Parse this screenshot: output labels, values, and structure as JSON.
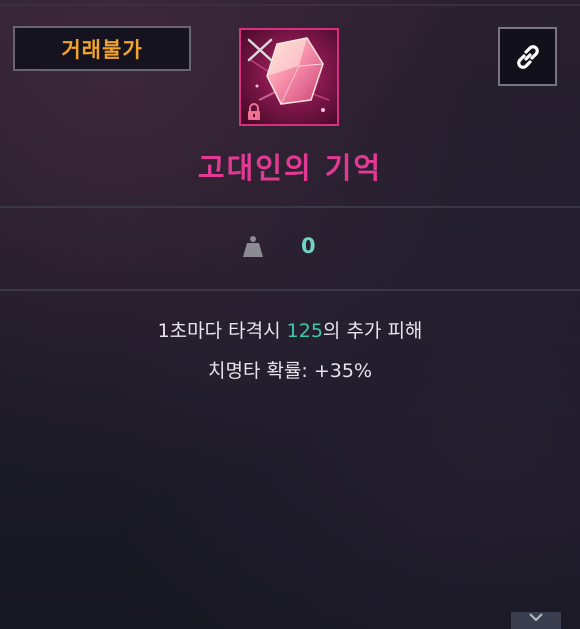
{
  "badge": {
    "label": "거래불가"
  },
  "item": {
    "name": "고대인의 기억",
    "rarity_color": "#e23a94",
    "icon": "pink-crystal-icon"
  },
  "weight": {
    "icon": "weight-icon",
    "value": "0"
  },
  "description": {
    "line1_prefix": "1초마다 타격시 ",
    "line1_value": "125",
    "line1_suffix": "의 추가 피해",
    "line2": "치명타 확률: +35%"
  },
  "colors": {
    "badge_text": "#f0a32e",
    "highlight": "#3ec9a5",
    "weight_value": "#74d2c5"
  },
  "buttons": {
    "link": "link-icon",
    "collapse": "chevron-down-icon"
  }
}
